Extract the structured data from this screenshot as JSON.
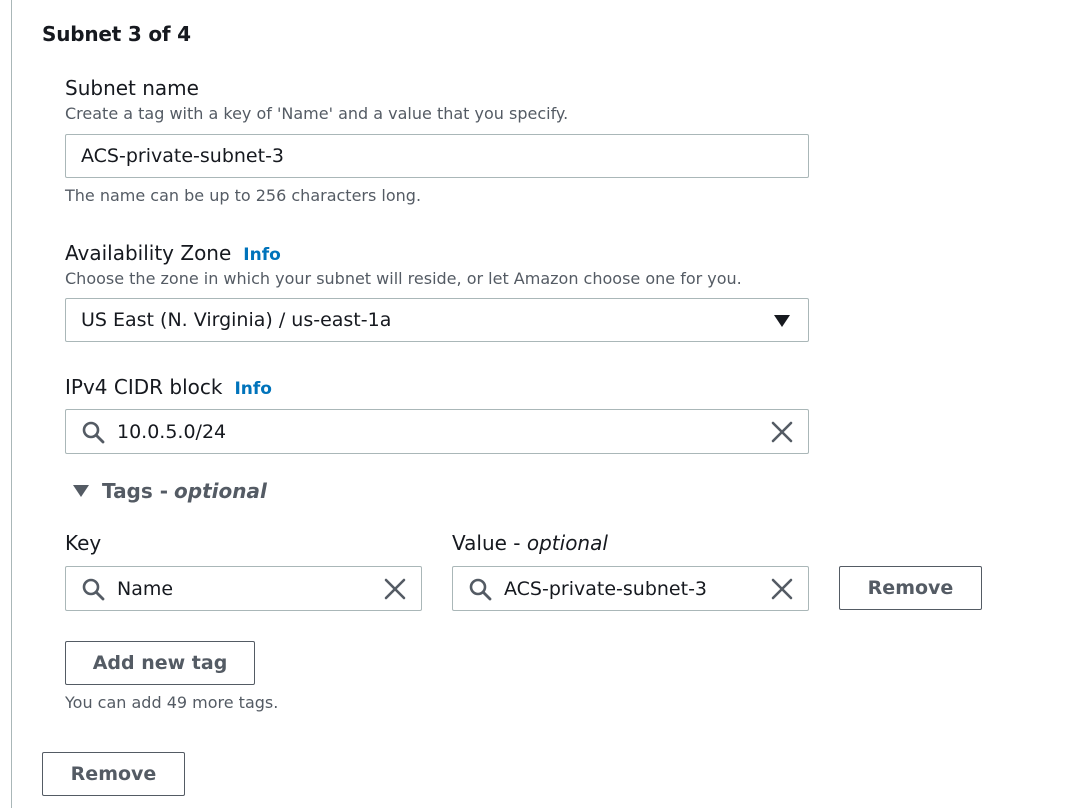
{
  "section": {
    "title": "Subnet 3 of 4",
    "remove_subnet_label": "Remove"
  },
  "subnet_name": {
    "label": "Subnet name",
    "description": "Create a tag with a key of 'Name' and a value that you specify.",
    "value": "ACS-private-subnet-3",
    "constraint": "The name can be up to 256 characters long."
  },
  "availability_zone": {
    "label": "Availability Zone",
    "info_link": "Info",
    "description": "Choose the zone in which your subnet will reside, or let Amazon choose one for you.",
    "selected": "US East (N. Virginia) / us-east-1a"
  },
  "cidr_block": {
    "label": "IPv4 CIDR block",
    "info_link": "Info",
    "value": "10.0.5.0/24"
  },
  "tags": {
    "toggle_label": "Tags -",
    "toggle_optional": "optional",
    "key_header": "Key",
    "value_header": "Value -",
    "value_header_optional": "optional",
    "rows": [
      {
        "key": "Name",
        "value": "ACS-private-subnet-3",
        "remove_label": "Remove"
      }
    ],
    "add_label": "Add new tag",
    "limit_note": "You can add 49 more tags."
  },
  "icons": {
    "search": "search-icon",
    "clear": "close-icon",
    "dropdown": "caret-down-icon",
    "expand": "caret-down-icon"
  },
  "colors": {
    "link": "#0073bb",
    "border": "#aab7b8",
    "text": "#16191f",
    "muted": "#545b64"
  }
}
